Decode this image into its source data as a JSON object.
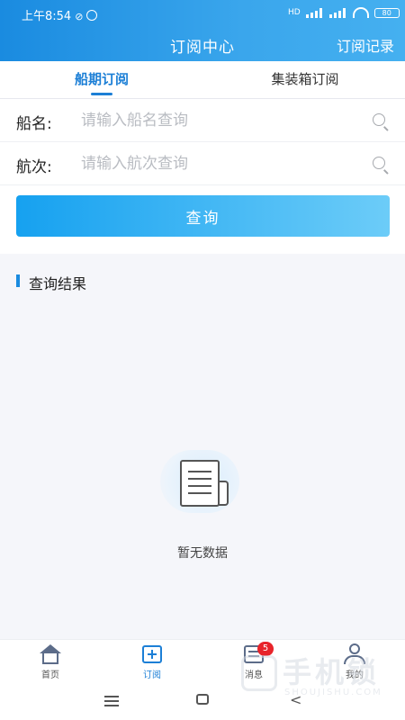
{
  "status_bar": {
    "time": "上午8:54",
    "battery": "80",
    "network_label": "HD"
  },
  "header": {
    "title": "订阅中心",
    "records_link": "订阅记录"
  },
  "tabs": [
    {
      "label": "船期订阅",
      "active": true
    },
    {
      "label": "集装箱订阅",
      "active": false
    }
  ],
  "form": {
    "ship_name_label": "船名:",
    "ship_name_placeholder": "请输入船名查询",
    "voyage_label": "航次:",
    "voyage_placeholder": "请输入航次查询",
    "query_button": "查询"
  },
  "results": {
    "title": "查询结果",
    "empty_text": "暂无数据"
  },
  "bottom_nav": [
    {
      "label": "首页",
      "icon": "home-icon"
    },
    {
      "label": "订阅",
      "icon": "subscribe-icon",
      "active": true
    },
    {
      "label": "消息",
      "icon": "message-icon",
      "badge": "5"
    },
    {
      "label": "我的",
      "icon": "profile-icon"
    }
  ],
  "watermark": {
    "text": "手机锁",
    "sub": "SHOUJISHU.COM"
  },
  "colors": {
    "accent": "#1c7fd6",
    "header_start": "#1a8be0",
    "badge": "#e8242a"
  }
}
